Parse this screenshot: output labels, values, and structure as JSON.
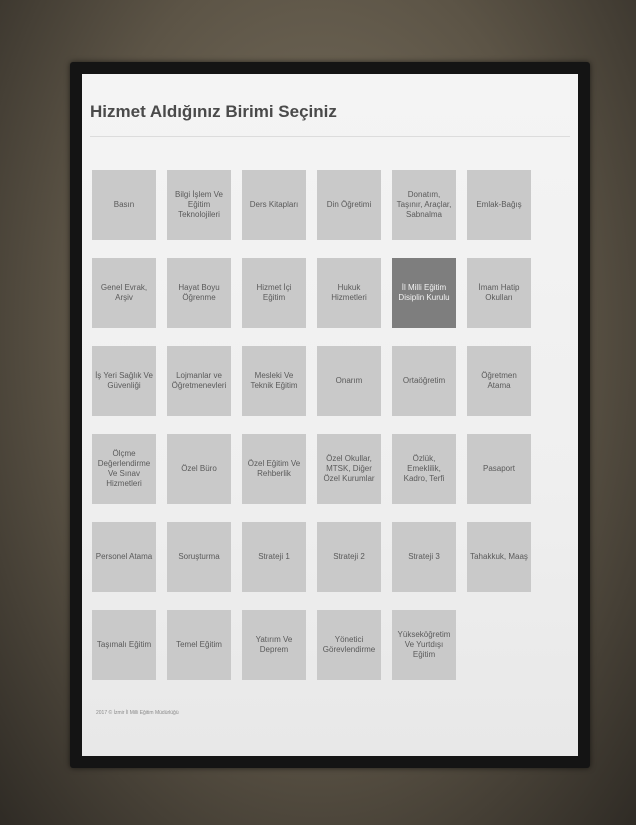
{
  "page": {
    "title": "Hizmet Aldığınız Birimi Seçiniz",
    "footer": "2017 © İzmir İl Milli Eğitim Müdürlüğü"
  },
  "colors": {
    "tile": "#c9c9c9",
    "tile_active": "#7e7e7e",
    "tile_text": "#5a5a5a",
    "title": "#4a4a4a"
  },
  "tiles": [
    {
      "label": "Basın",
      "active": false
    },
    {
      "label": "Bilgi İşlem Ve Eğitim Teknolojileri",
      "active": false
    },
    {
      "label": "Ders Kitapları",
      "active": false
    },
    {
      "label": "Din Öğretimi",
      "active": false
    },
    {
      "label": "Donatım, Taşınır, Araçlar, Sabnalma",
      "active": false
    },
    {
      "label": "Emlak-Bağış",
      "active": false
    },
    {
      "label": "Genel Evrak, Arşiv",
      "active": false
    },
    {
      "label": "Hayat Boyu Öğrenme",
      "active": false
    },
    {
      "label": "Hizmet İçi Eğitim",
      "active": false
    },
    {
      "label": "Hukuk Hizmetleri",
      "active": false
    },
    {
      "label": "İl Milli Eğitim Disiplin Kurulu",
      "active": true
    },
    {
      "label": "İmam Hatip Okulları",
      "active": false
    },
    {
      "label": "İş Yeri Sağlık Ve Güvenliği",
      "active": false
    },
    {
      "label": "Lojmanlar ve Öğretmenevleri",
      "active": false
    },
    {
      "label": "Mesleki Ve Teknik Eğitim",
      "active": false
    },
    {
      "label": "Onarım",
      "active": false
    },
    {
      "label": "Ortaöğretim",
      "active": false
    },
    {
      "label": "Öğretmen Atama",
      "active": false
    },
    {
      "label": "Ölçme Değerlendirme Ve Sınav Hizmetleri",
      "active": false
    },
    {
      "label": "Özel Büro",
      "active": false
    },
    {
      "label": "Özel Eğitim Ve Rehberlik",
      "active": false
    },
    {
      "label": "Özel Okullar, MTSK, Diğer Özel Kurumlar",
      "active": false
    },
    {
      "label": "Özlük, Emeklilik, Kadro, Terfi",
      "active": false
    },
    {
      "label": "Pasaport",
      "active": false
    },
    {
      "label": "Personel Atama",
      "active": false
    },
    {
      "label": "Soruşturma",
      "active": false
    },
    {
      "label": "Strateji 1",
      "active": false
    },
    {
      "label": "Strateji 2",
      "active": false
    },
    {
      "label": "Strateji 3",
      "active": false
    },
    {
      "label": "Tahakkuk, Maaş",
      "active": false
    },
    {
      "label": "Taşımalı Eğitim",
      "active": false
    },
    {
      "label": "Temel Eğitim",
      "active": false
    },
    {
      "label": "Yatırım Ve Deprem",
      "active": false
    },
    {
      "label": "Yönetici Görevlendirme",
      "active": false
    },
    {
      "label": "Yükseköğretim Ve Yurtdışı Eğitim",
      "active": false
    }
  ]
}
